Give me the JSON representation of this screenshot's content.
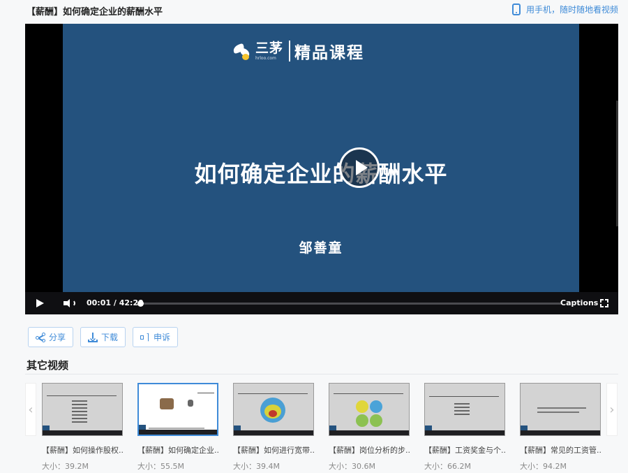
{
  "header": {
    "title": "【薪酬】如何确定企业的薪酬水平",
    "mobile_link": "用手机，随时随地看视频"
  },
  "player": {
    "slide": {
      "brand": "三茅",
      "brand_url": "hrloo.com",
      "course_label": "精品课程",
      "title": "如何确定企业的薪酬水平",
      "author": "邹善童"
    },
    "controls": {
      "current_time": "00:01",
      "separator": "/",
      "duration": "42:29",
      "progress_fraction": 0.0004,
      "captions_label": "Captions"
    }
  },
  "actions": {
    "share": "分享",
    "download": "下载",
    "report": "申诉"
  },
  "other_videos": {
    "heading": "其它视频",
    "items": [
      {
        "title": "【薪酬】如何操作股权...",
        "size": "大小：39.2M"
      },
      {
        "title": "【薪酬】如何确定企业...",
        "size": "大小：55.5M"
      },
      {
        "title": "【薪酬】如何进行宽带...",
        "size": "大小：39.4M"
      },
      {
        "title": "【薪酬】岗位分析的步...",
        "size": "大小：30.6M"
      },
      {
        "title": "【薪酬】工资奖金与个...",
        "size": "大小：66.2M"
      },
      {
        "title": "【薪酬】常见的工资管...",
        "size": "大小：94.2M"
      }
    ]
  },
  "colors": {
    "accent": "#3f8bd8",
    "slide_bg": "#24527e"
  }
}
